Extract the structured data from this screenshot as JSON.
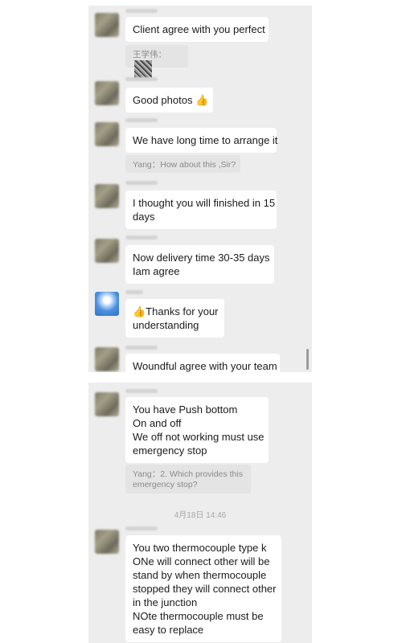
{
  "screenshot_top": {
    "messages": [
      {
        "type": "text",
        "lines": [
          "Client agree with you perfect"
        ]
      },
      {
        "type": "quote",
        "prefix": "王学伟：",
        "has_image": true
      },
      {
        "type": "text",
        "lines": [
          "Good photos 👍"
        ]
      },
      {
        "type": "text",
        "lines": [
          "We have long time to arrange it"
        ]
      },
      {
        "type": "quote",
        "lines": [
          "Yang：How about this ,Sir?"
        ]
      },
      {
        "type": "text",
        "lines": [
          "I thought you will finished in 15",
          "days"
        ]
      },
      {
        "type": "text",
        "lines": [
          "Now delivery time 30-35 days",
          "Iam agree"
        ]
      },
      {
        "type": "text",
        "lines": [
          "👍Thanks for your",
          "understanding"
        ]
      },
      {
        "type": "text",
        "lines": [
          "Woundful agree with your team"
        ]
      }
    ]
  },
  "screenshot_bottom": {
    "messages": [
      {
        "type": "text",
        "lines": [
          "You have Push bottom",
          "On and off",
          "We off not working must use",
          "emergency stop"
        ]
      },
      {
        "type": "quote",
        "lines": [
          "Yang：2. Which provides this",
          "emergency stop?"
        ]
      },
      {
        "type": "text",
        "lines": [
          "You two thermocouple type k",
          "ONe will connect other will be",
          "stand by when thermocouple",
          "stopped they will connect other",
          "in the junction",
          "NOte thermocouple must be",
          "easy to replace"
        ]
      }
    ],
    "timestamp": "4月18日 14:46"
  },
  "icons": {
    "thumbs_up": "👍",
    "avatar_sender": "blurred-avatar",
    "avatar_self": "sky-avatar"
  },
  "colors": {
    "chat_background": "#ededed",
    "bubble": "#ffffff",
    "quote_background": "#e4e4e4",
    "quote_text": "#8a8a8a",
    "timestamp_text": "#a7a7a7"
  }
}
